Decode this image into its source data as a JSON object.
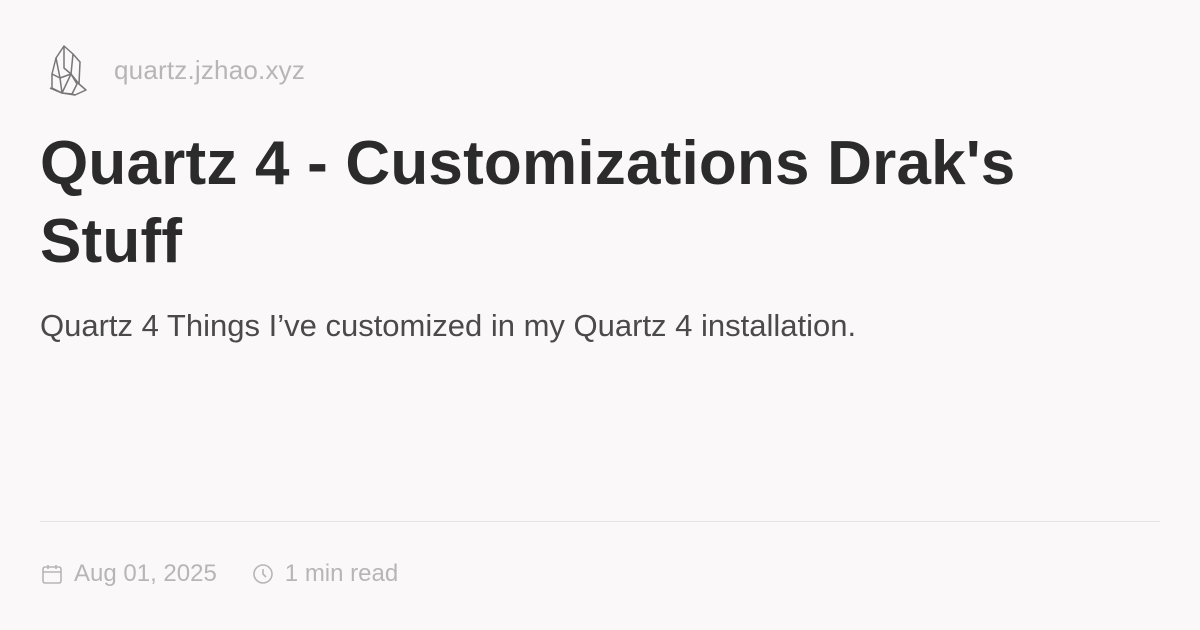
{
  "header": {
    "site_url": "quartz.jzhao.xyz",
    "logo_icon": "crystal-quartz-icon"
  },
  "article": {
    "title": "Quartz 4 - Customizations Drak's Stuff",
    "description": "Quartz 4 Things I’ve customized in my Quartz 4 installation."
  },
  "meta": {
    "date": "Aug 01, 2025",
    "read_time": "1 min read",
    "date_icon": "calendar-icon",
    "time_icon": "clock-icon"
  },
  "colors": {
    "background": "#faf8f8",
    "text_primary": "#2b2b2b",
    "text_muted": "#b7b5b5",
    "divider": "#e6e3e3"
  }
}
